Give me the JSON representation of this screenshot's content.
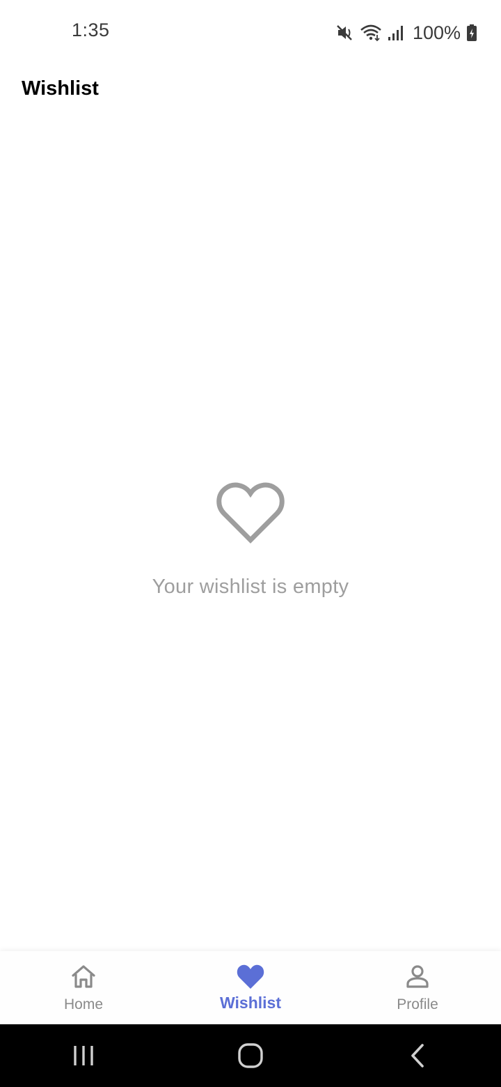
{
  "status_bar": {
    "time": "1:35",
    "battery": "100%",
    "icons": [
      "mute-icon",
      "wifi-icon",
      "signal-icon",
      "battery-charging-icon"
    ]
  },
  "app_bar": {
    "title": "Wishlist"
  },
  "empty_state": {
    "icon": "heart-outline-icon",
    "message": "Your wishlist is empty"
  },
  "bottom_nav": {
    "items": [
      {
        "label": "Home",
        "icon": "home-icon",
        "active": false
      },
      {
        "label": "Wishlist",
        "icon": "heart-icon",
        "active": true
      },
      {
        "label": "Profile",
        "icon": "person-icon",
        "active": false
      }
    ]
  },
  "colors": {
    "accent": "#5b6fd6",
    "muted": "#9e9e9e",
    "inactive_nav": "#8a8a8a"
  },
  "system_nav": {
    "icons": [
      "recents-icon",
      "home-circle-icon",
      "back-icon"
    ]
  }
}
